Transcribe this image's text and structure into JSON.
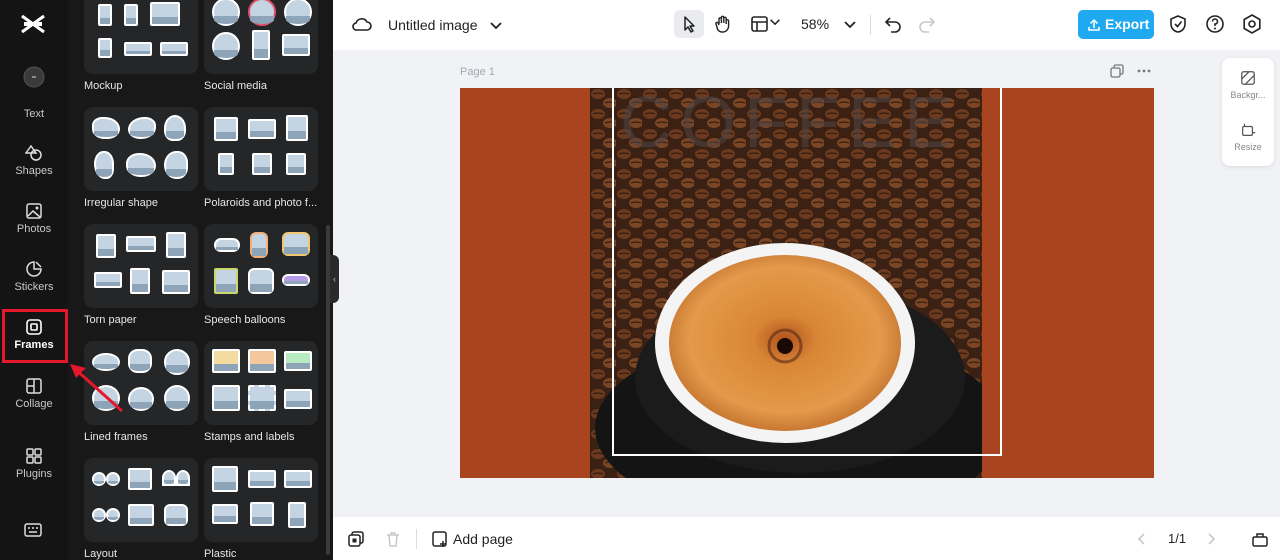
{
  "rail": {
    "items": [
      {
        "label": "Text"
      },
      {
        "label": "Shapes"
      },
      {
        "label": "Photos"
      },
      {
        "label": "Stickers"
      },
      {
        "label": "Frames"
      },
      {
        "label": "Collage"
      },
      {
        "label": "Plugins"
      }
    ]
  },
  "panel": {
    "categories": [
      {
        "label": "Mockup"
      },
      {
        "label": "Social media"
      },
      {
        "label": "Irregular shape"
      },
      {
        "label": "Polaroids and photo f..."
      },
      {
        "label": "Torn paper"
      },
      {
        "label": "Speech balloons"
      },
      {
        "label": "Lined frames"
      },
      {
        "label": "Stamps and labels"
      },
      {
        "label": "Layout"
      },
      {
        "label": "Plastic"
      }
    ]
  },
  "topbar": {
    "title": "Untitled image",
    "zoom": "58%",
    "export_label": "Export"
  },
  "canvas": {
    "page_label": "Page 1",
    "overlay_text": "COFFEE",
    "background_color": "#a84520"
  },
  "side_tools": {
    "background_label": "Backgr...",
    "resize_label": "Resize"
  },
  "bottombar": {
    "add_page_label": "Add page",
    "page_indicator": "1/1"
  },
  "colors": {
    "accent": "#1fa9f1",
    "highlight": "#e5172b"
  }
}
